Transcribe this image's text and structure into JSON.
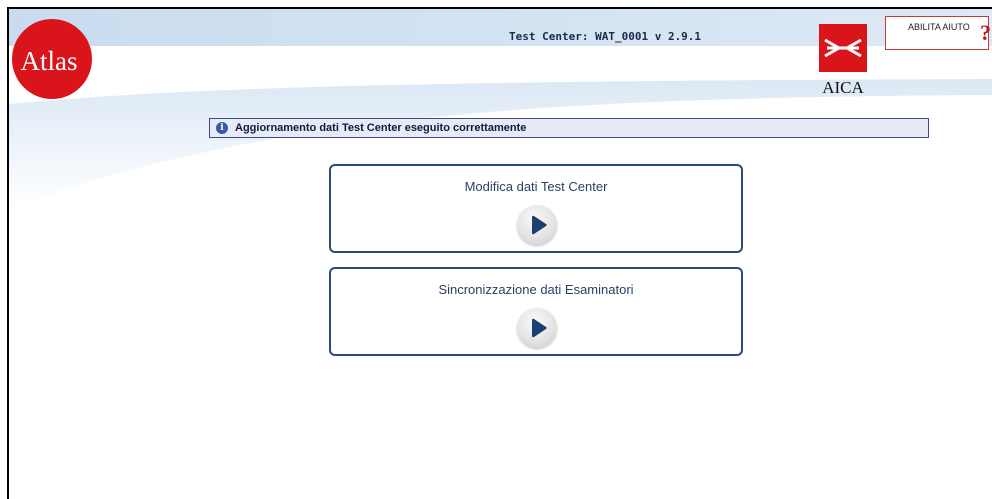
{
  "header": {
    "title": "Test Center: WAT_0001 v 2.9.1",
    "logo_left_text": "Atlas",
    "logo_right_text": "AICA"
  },
  "help": {
    "label": "ABILITA AIUTO",
    "icon": "question-mark-icon"
  },
  "message": {
    "icon": "info-icon",
    "text": "Aggiornamento dati Test Center eseguito correttamente"
  },
  "actions": [
    {
      "label": "Modifica dati Test Center",
      "icon": "play-icon"
    },
    {
      "label": "Sincronizzazione dati Esaminatori",
      "icon": "play-icon"
    }
  ],
  "colors": {
    "accent": "#2b4a75",
    "brand_red": "#d9141b",
    "header_band": "#d3e2f2"
  }
}
